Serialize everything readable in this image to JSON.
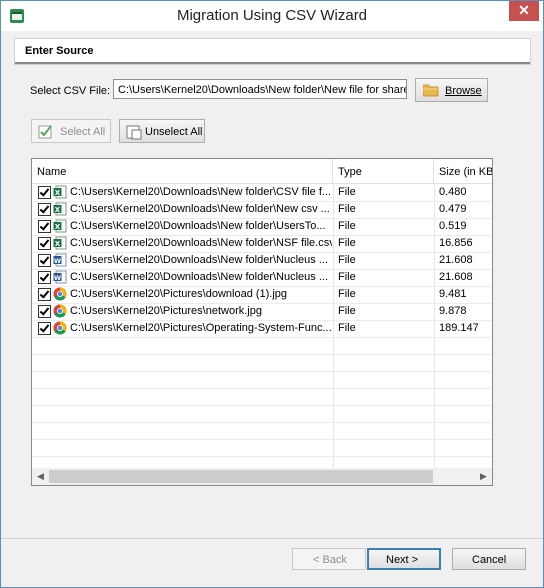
{
  "window": {
    "title": "Migration Using CSV Wizard",
    "close": "✕"
  },
  "section": {
    "title": "Enter Source"
  },
  "csv": {
    "label": "Select CSV File:",
    "path": "C:\\Users\\Kernel20\\Downloads\\New folder\\New file for share",
    "browse_label": "Browse"
  },
  "selection": {
    "select_all": "Select All",
    "unselect_all": "Unselect All"
  },
  "list": {
    "columns": [
      "Name",
      "Type",
      "Size (in KB"
    ],
    "rows": [
      {
        "name": "C:\\Users\\Kernel20\\Downloads\\New folder\\CSV file f...",
        "type": "File",
        "size": "0.480",
        "icon": "excel-file-icon"
      },
      {
        "name": "C:\\Users\\Kernel20\\Downloads\\New folder\\New csv ...",
        "type": "File",
        "size": "0.479",
        "icon": "excel-file-icon"
      },
      {
        "name": "C:\\Users\\Kernel20\\Downloads\\New folder\\UsersTo...",
        "type": "File",
        "size": "0.519",
        "icon": "excel-file-icon"
      },
      {
        "name": "C:\\Users\\Kernel20\\Downloads\\New folder\\NSF file.csv",
        "type": "File",
        "size": "16.856",
        "icon": "excel-file-icon"
      },
      {
        "name": "C:\\Users\\Kernel20\\Downloads\\New folder\\Nucleus ...",
        "type": "File",
        "size": "21.608",
        "icon": "word-file-icon"
      },
      {
        "name": "C:\\Users\\Kernel20\\Downloads\\New folder\\Nucleus ...",
        "type": "File",
        "size": "21.608",
        "icon": "word-file-icon"
      },
      {
        "name": "C:\\Users\\Kernel20\\Pictures\\download (1).jpg",
        "type": "File",
        "size": "9.481",
        "icon": "chrome-file-icon"
      },
      {
        "name": "C:\\Users\\Kernel20\\Pictures\\network.jpg",
        "type": "File",
        "size": "9.878",
        "icon": "chrome-file-icon"
      },
      {
        "name": "C:\\Users\\Kernel20\\Pictures\\Operating-System-Func...",
        "type": "File",
        "size": "189.147",
        "icon": "chrome-file-icon"
      }
    ]
  },
  "footer": {
    "back": "< Back",
    "next": "Next >",
    "cancel": "Cancel"
  }
}
